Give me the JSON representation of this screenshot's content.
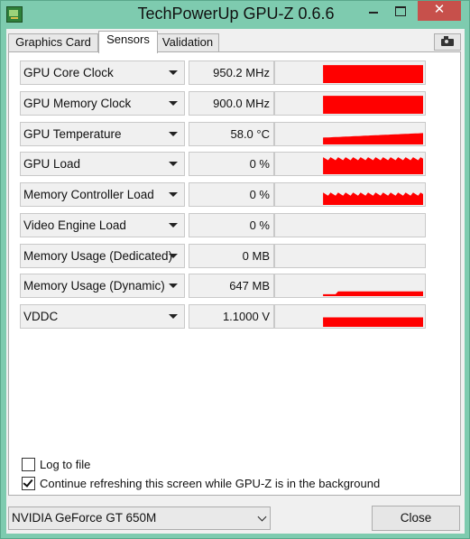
{
  "window": {
    "title": "TechPowerUp GPU-Z 0.6.6",
    "minimize_glyph": "",
    "close_glyph": "✕"
  },
  "tabs": [
    {
      "label": "Graphics Card",
      "active": false
    },
    {
      "label": "Sensors",
      "active": true
    },
    {
      "label": "Validation",
      "active": false
    }
  ],
  "toolbar": {
    "camera_icon": "camera-icon"
  },
  "colors": {
    "graph_fill": "#ff0000",
    "accent": "#74c2a4"
  },
  "sensors": [
    {
      "name": "GPU Core Clock",
      "value": "950.2 MHz",
      "level": 0.95
    },
    {
      "name": "GPU Memory Clock",
      "value": "900.0 MHz",
      "level": 0.95
    },
    {
      "name": "GPU Temperature",
      "value": "58.0 °C",
      "level": 0.6
    },
    {
      "name": "GPU Load",
      "value": "0 %",
      "level": 0.9
    },
    {
      "name": "Memory Controller Load",
      "value": "0 %",
      "level": 0.65
    },
    {
      "name": "Video Engine Load",
      "value": "0 %",
      "level": 0
    },
    {
      "name": "Memory Usage (Dedicated)",
      "value": "0 MB",
      "level": 0
    },
    {
      "name": "Memory Usage (Dynamic)",
      "value": "647 MB",
      "level": 0.25
    },
    {
      "name": "VDDC",
      "value": "1.1000 V",
      "level": 0.5
    }
  ],
  "options": {
    "log_to_file": {
      "label": "Log to file",
      "checked": false
    },
    "continue_refresh": {
      "label": "Continue refreshing this screen while GPU-Z is in the background",
      "checked": true
    }
  },
  "footer": {
    "gpu_select": "NVIDIA GeForce GT 650M",
    "close_label": "Close"
  }
}
